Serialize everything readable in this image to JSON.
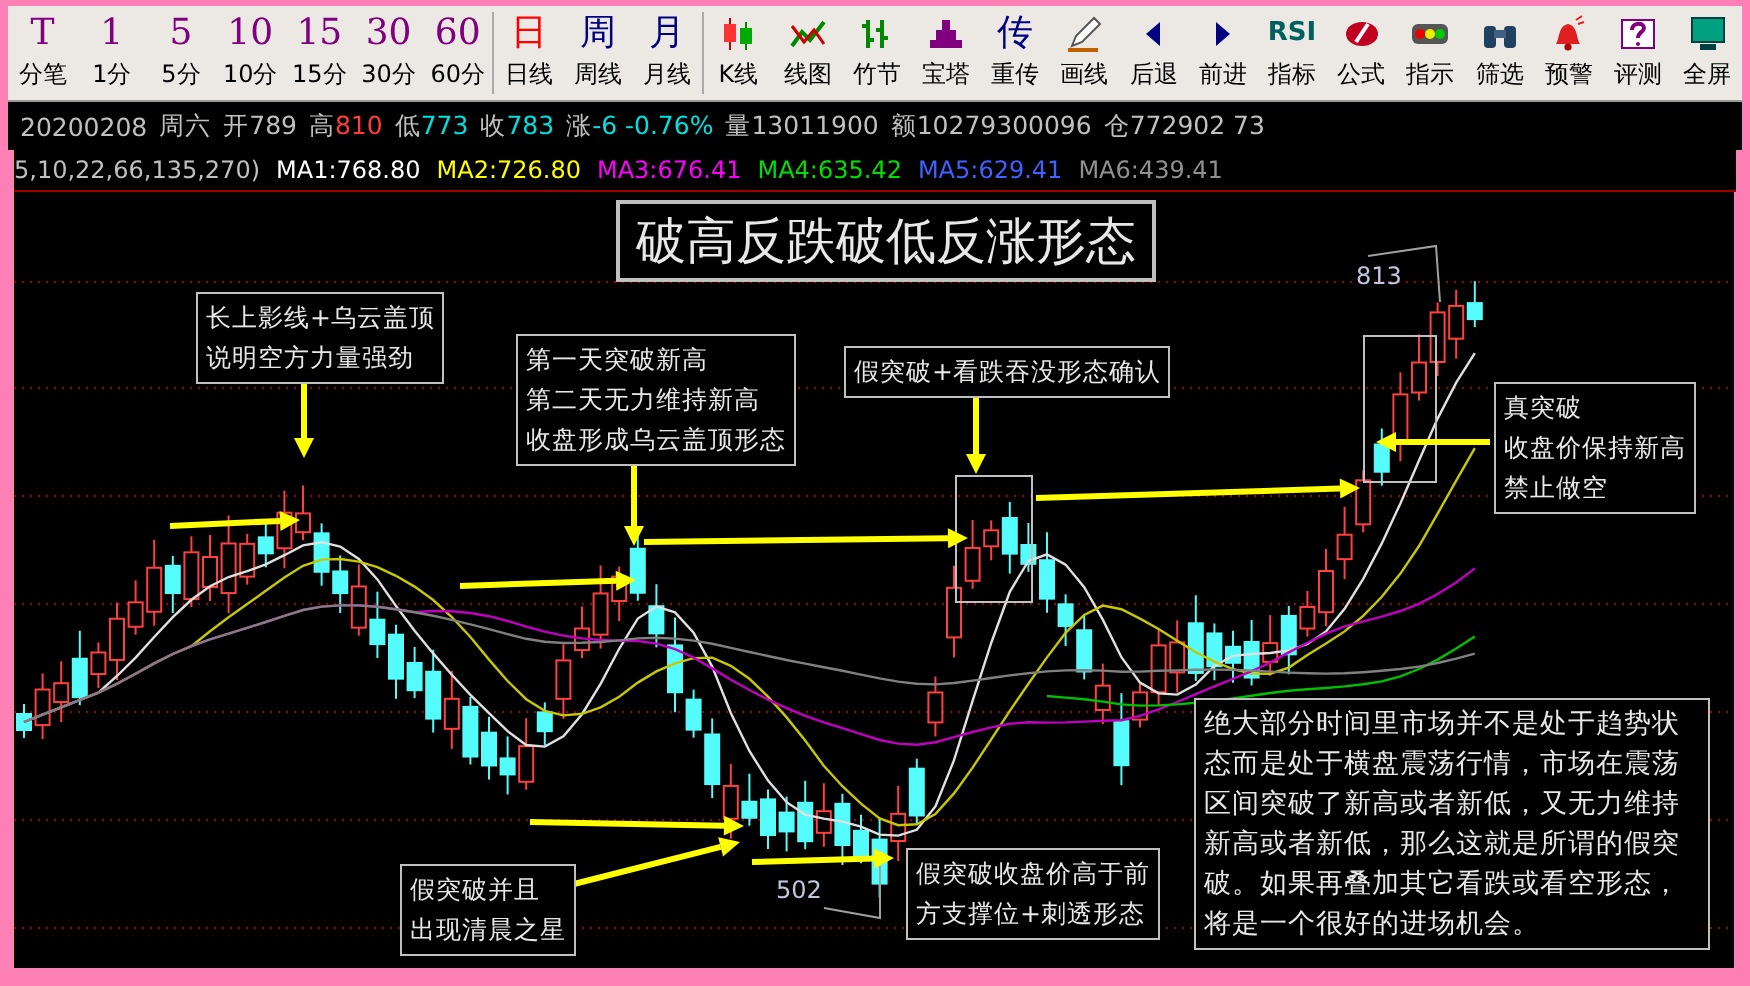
{
  "toolbar": [
    {
      "kind": "glyph",
      "glyph": "T",
      "label": "分笔",
      "color": "#800080"
    },
    {
      "kind": "glyph",
      "glyph": "1",
      "label": "1分",
      "color": "#800080"
    },
    {
      "kind": "glyph",
      "glyph": "5",
      "label": "5分",
      "color": "#800080"
    },
    {
      "kind": "glyph",
      "glyph": "10",
      "label": "10分",
      "color": "#800080"
    },
    {
      "kind": "glyph",
      "glyph": "15",
      "label": "15分",
      "color": "#800080"
    },
    {
      "kind": "glyph",
      "glyph": "30",
      "label": "30分",
      "color": "#800080"
    },
    {
      "kind": "glyph",
      "glyph": "60",
      "label": "60分",
      "color": "#800080"
    },
    {
      "kind": "glyph",
      "glyph": "日",
      "label": "日线",
      "color": "#ff0000"
    },
    {
      "kind": "glyph",
      "glyph": "周",
      "label": "周线",
      "color": "#000080"
    },
    {
      "kind": "glyph",
      "glyph": "月",
      "label": "月线",
      "color": "#000080"
    },
    {
      "kind": "icon",
      "label": "K线"
    },
    {
      "kind": "icon",
      "label": "线图"
    },
    {
      "kind": "icon",
      "label": "竹节"
    },
    {
      "kind": "icon",
      "label": "宝塔"
    },
    {
      "kind": "glyph",
      "glyph": "传",
      "label": "重传",
      "color": "#000080"
    },
    {
      "kind": "icon",
      "label": "画线"
    },
    {
      "kind": "icon",
      "label": "后退"
    },
    {
      "kind": "icon",
      "label": "前进"
    },
    {
      "kind": "glyph",
      "glyph": "RSI",
      "label": "指标",
      "color": "#006060"
    },
    {
      "kind": "icon",
      "label": "公式"
    },
    {
      "kind": "icon",
      "label": "指示"
    },
    {
      "kind": "icon",
      "label": "筛选"
    },
    {
      "kind": "icon",
      "label": "预警"
    },
    {
      "kind": "icon",
      "label": "评测"
    },
    {
      "kind": "icon",
      "label": "全屏"
    }
  ],
  "quote_bar": [
    {
      "label": "20200208",
      "color": "#c0c0c0"
    },
    {
      "label": "周六",
      "color": "#c0c0c0"
    },
    {
      "label": "开",
      "value": "789",
      "color": "#c0c0c0"
    },
    {
      "label": "高",
      "value": "810",
      "color": "#ff3c3c"
    },
    {
      "label": "低",
      "value": "773",
      "color": "#00e0e0"
    },
    {
      "label": "收",
      "value": "783",
      "color": "#00e0e0"
    },
    {
      "label": "涨",
      "value": "-6 -0.76%",
      "color": "#00e0e0"
    },
    {
      "label": "量",
      "value": "13011900",
      "color": "#c0c0c0"
    },
    {
      "label": "额",
      "value": "10279300096",
      "color": "#c0c0c0"
    },
    {
      "label": "仓",
      "value": "772902 73",
      "color": "#c0c0c0"
    }
  ],
  "ma_bar": {
    "prefix": "5,10,22,66,135,270)",
    "items": [
      {
        "label": "MA1:768.80",
        "color": "#ffffff"
      },
      {
        "label": "MA2:726.80",
        "color": "#ffff00"
      },
      {
        "label": "MA3:676.41",
        "color": "#ff00ff"
      },
      {
        "label": "MA4:635.42",
        "color": "#00e000"
      },
      {
        "label": "MA5:629.41",
        "color": "#4060ff"
      },
      {
        "label": "MA6:439.41",
        "color": "#909090"
      }
    ]
  },
  "chart": {
    "title": "破高反跌破低反涨形态",
    "price_labels": [
      "813",
      "502"
    ],
    "annotations": [
      {
        "kind": "lines",
        "lines": [
          "长上影线+乌云盖顶",
          "说明空方力量强劲"
        ]
      },
      {
        "kind": "lines",
        "lines": [
          "第一天突破新高",
          "第二天无力维持新高",
          "收盘形成乌云盖顶形态"
        ]
      },
      {
        "kind": "lines",
        "lines": [
          "假突破+看跌吞没形态确认"
        ]
      },
      {
        "kind": "lines",
        "lines": [
          "真突破",
          "收盘价保持新高",
          "禁止做空"
        ]
      },
      {
        "kind": "lines",
        "lines": [
          "假突破并且",
          "出现清晨之星"
        ]
      },
      {
        "kind": "lines",
        "lines": [
          "假突破收盘价高于前",
          "方支撑位+刺透形态"
        ]
      },
      {
        "kind": "paragraph",
        "text": "绝大部分时间里市场并不是处于趋势状态而是处于横盘震荡行情，市场在震荡区间突破了新高或者新低，又无力维持新高或者新低，那么这就是所谓的假突破。如果再叠加其它看跌或看空形态，将是一个很好的进场机会。"
      }
    ]
  }
}
